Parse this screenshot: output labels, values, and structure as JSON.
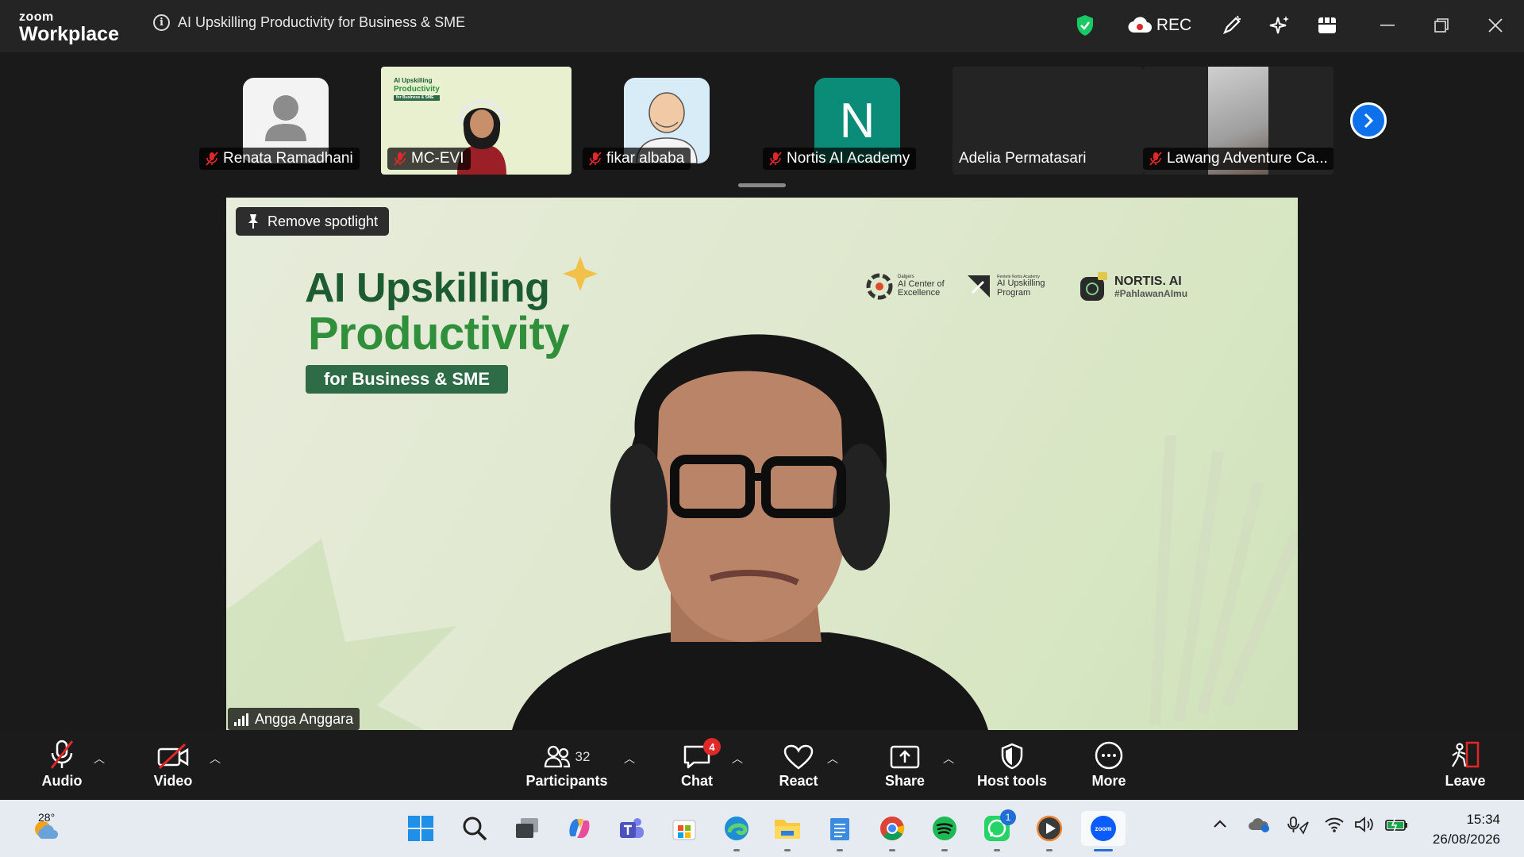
{
  "app": {
    "logo_top": "zoom",
    "logo_bottom": "Workplace"
  },
  "meeting": {
    "title": "AI Upskilling Productivity for Business & SME"
  },
  "titlebar": {
    "rec_label": "REC"
  },
  "filmstrip": {
    "participants": [
      {
        "name": "Renata Ramadhani",
        "muted": true
      },
      {
        "name": "MC-EVI",
        "muted": true
      },
      {
        "name": "fikar albaba",
        "muted": true
      },
      {
        "name": "Nortis AI Academy",
        "muted": true,
        "avatar_letter": "N"
      },
      {
        "name": "Adelia Permatasari",
        "muted": false
      },
      {
        "name": "Lawang Adventure Ca...",
        "muted": true
      }
    ],
    "thumb_slide": {
      "line1": "AI Upskilling",
      "line2": "Productivity",
      "line3": "for Business & SME"
    }
  },
  "spotlight": {
    "remove_label": "Remove spotlight",
    "speaker": "Angga Anggara",
    "slide": {
      "title_line1": "AI Upskilling",
      "title_line2": "Productivity",
      "subtitle": "for Business & SME",
      "sponsors": [
        {
          "line1": "Dalgers",
          "line2": "AI Center of",
          "line3": "Excellence"
        },
        {
          "line1": "Rentete Nortis Academy",
          "line2": "AI Upskilling",
          "line3": "Program"
        },
        {
          "line1": "NORTIS. AI",
          "line2": "#PahlawanAImu"
        }
      ]
    }
  },
  "toolbar": {
    "audio": "Audio",
    "video": "Video",
    "participants": "Participants",
    "participants_count": "32",
    "chat": "Chat",
    "chat_badge": "4",
    "react": "React",
    "share": "Share",
    "host_tools": "Host tools",
    "more": "More",
    "leave": "Leave"
  },
  "taskbar": {
    "weather_temp": "28°",
    "whatsapp_badge": "1",
    "time": "15:34",
    "date": "26/08/2026"
  },
  "colors": {
    "accent_blue": "#0e71eb",
    "mute_red": "#e02828",
    "slide_dark_green": "#1d5c33",
    "slide_green": "#2f8f3b",
    "shield_green": "#18c964"
  }
}
